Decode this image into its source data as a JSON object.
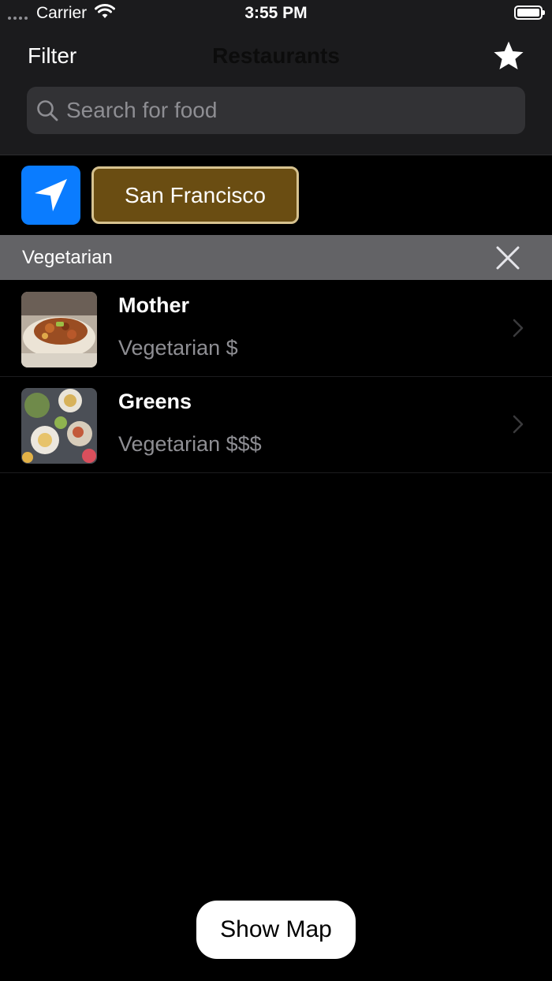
{
  "status_bar": {
    "carrier": "Carrier",
    "time": "3:55 PM"
  },
  "nav": {
    "filter_label": "Filter",
    "title": "Restaurants",
    "favorites_icon": "star-icon"
  },
  "search": {
    "placeholder": "Search for food",
    "value": ""
  },
  "location": {
    "icon": "location-arrow-icon",
    "city": "San Francisco",
    "accent_color": "#0a7cff",
    "city_bg_color": "#6a4d12"
  },
  "filter_chip": {
    "label": "Vegetarian",
    "clear_icon": "close-icon"
  },
  "restaurants": [
    {
      "name": "Mother",
      "detail": "Vegetarian $"
    },
    {
      "name": "Greens",
      "detail": "Vegetarian $$$"
    }
  ],
  "show_map_label": "Show Map"
}
